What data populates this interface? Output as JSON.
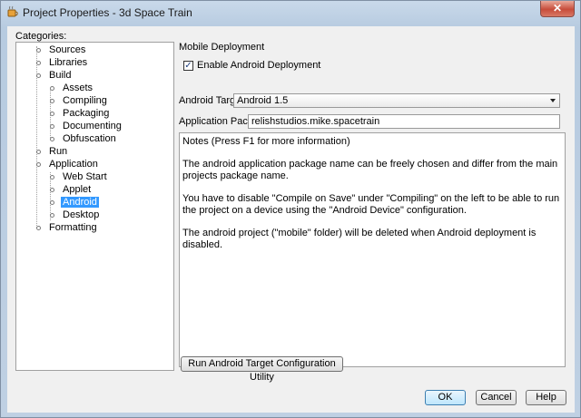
{
  "window": {
    "title": "Project Properties - 3d Space Train",
    "close_label": "✕"
  },
  "categories_label": "Categories:",
  "tree": [
    {
      "label": "Sources"
    },
    {
      "label": "Libraries"
    },
    {
      "label": "Build"
    },
    {
      "label": "Assets"
    },
    {
      "label": "Compiling"
    },
    {
      "label": "Packaging"
    },
    {
      "label": "Documenting"
    },
    {
      "label": "Obfuscation"
    },
    {
      "label": "Run"
    },
    {
      "label": "Application"
    },
    {
      "label": "Web Start"
    },
    {
      "label": "Applet"
    },
    {
      "label": "Android"
    },
    {
      "label": "Desktop"
    },
    {
      "label": "Formatting"
    }
  ],
  "panel": {
    "section_title": "Mobile Deployment",
    "enable_checkbox": {
      "label": "Enable Android Deployment",
      "checked": true
    },
    "android_target": {
      "label": "Android Target",
      "value": "Android 1.5"
    },
    "application_package": {
      "label": "Application Package",
      "value": "relishstudios.mike.spacetrain"
    },
    "notes": [
      "Notes  (Press F1 for more information)",
      "The android application package name can be freely chosen and differ from the main projects package name.",
      "You have to disable \"Compile on Save\" under \"Compiling\" on the left to be able to run the project on a device using the \"Android Device\" configuration.",
      "The android project (\"mobile\" folder) will be deleted when Android deployment is disabled."
    ],
    "utility_button": "Run Android Target Configuration Utility"
  },
  "buttons": {
    "ok": "OK",
    "cancel": "Cancel",
    "help": "Help"
  }
}
